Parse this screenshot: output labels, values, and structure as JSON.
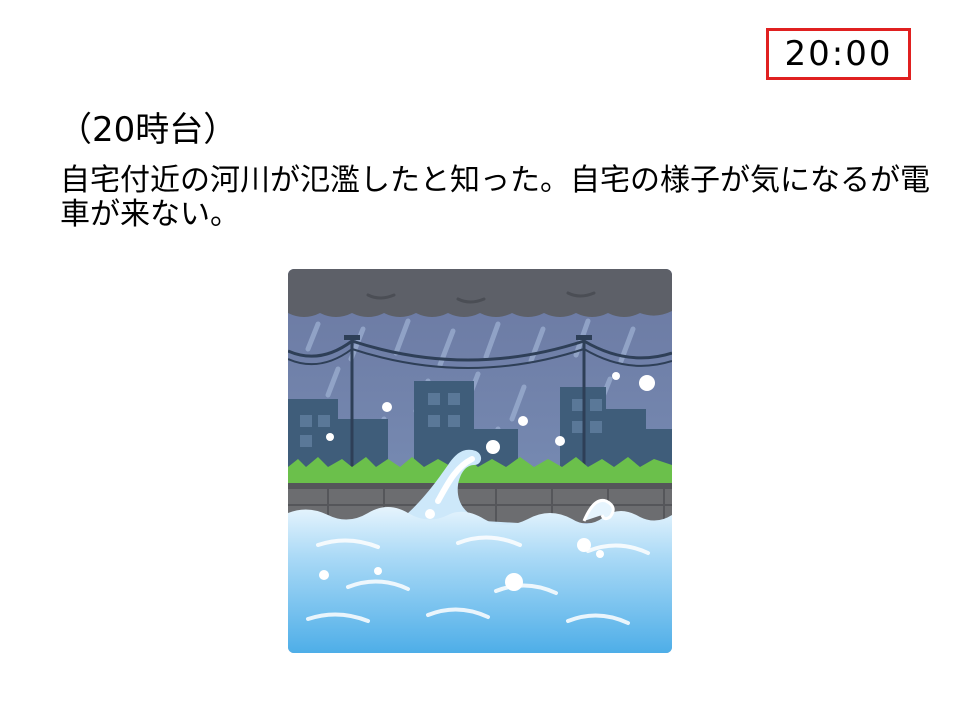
{
  "slide": {
    "time_label": "20:00",
    "heading": "（20時台）",
    "body": "自宅付近の河川が氾濫したと知った。自宅の様子が気になるが電車が来ない。"
  },
  "illustration": {
    "icon": "flood-illustration",
    "colors": {
      "sky": "#6f7fa4",
      "cloud": "#5d6068",
      "building": "#3f5d7a",
      "grass": "#6bc04b",
      "embankment": "#6c6d70",
      "water": "#5eb6ea",
      "foam": "#ffffff"
    }
  }
}
